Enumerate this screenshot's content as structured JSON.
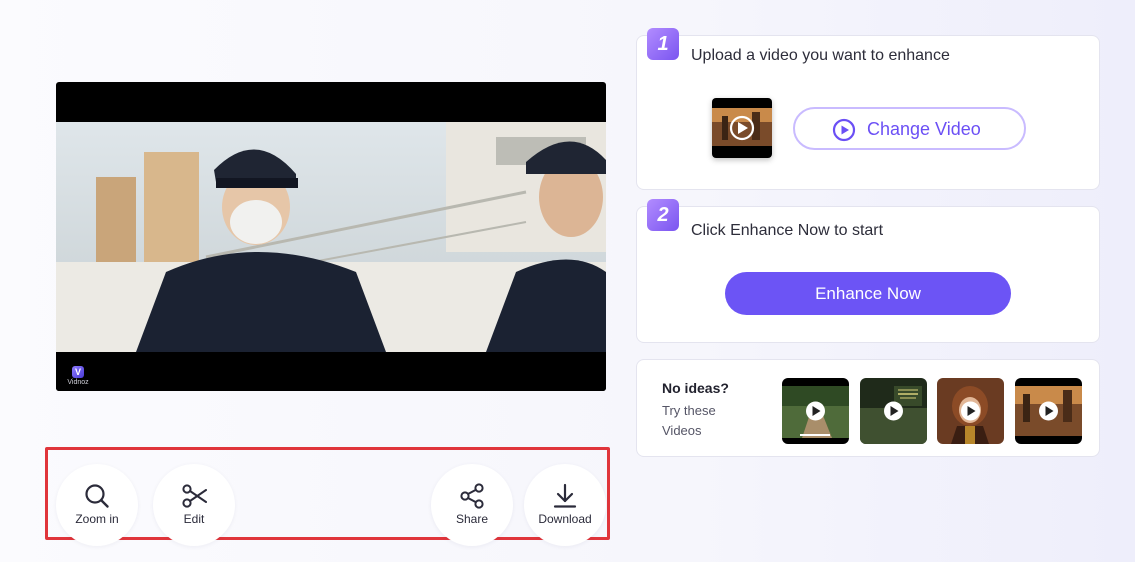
{
  "preview": {
    "watermark_text": "Vidnoz",
    "watermark_mark": "V"
  },
  "toolbar": {
    "zoom_label": "Zoom in",
    "edit_label": "Edit",
    "share_label": "Share",
    "download_label": "Download"
  },
  "step1": {
    "number": "1",
    "title": "Upload a video you want to enhance",
    "change_label": "Change Video"
  },
  "step2": {
    "number": "2",
    "title": "Click Enhance Now to start",
    "enhance_label": "Enhance Now"
  },
  "ideas": {
    "title": "No ideas?",
    "subtitle": "Try these Videos"
  },
  "colors": {
    "accent": "#6c54f5",
    "accent_border": "#c9bbff",
    "badge_from": "#b28cff",
    "badge_to": "#7a55f0",
    "highlight_frame": "#e0353b"
  },
  "icons": {
    "zoom": "search-icon",
    "edit": "scissors-icon",
    "share": "share-icon",
    "download": "download-icon",
    "play": "play-icon"
  }
}
